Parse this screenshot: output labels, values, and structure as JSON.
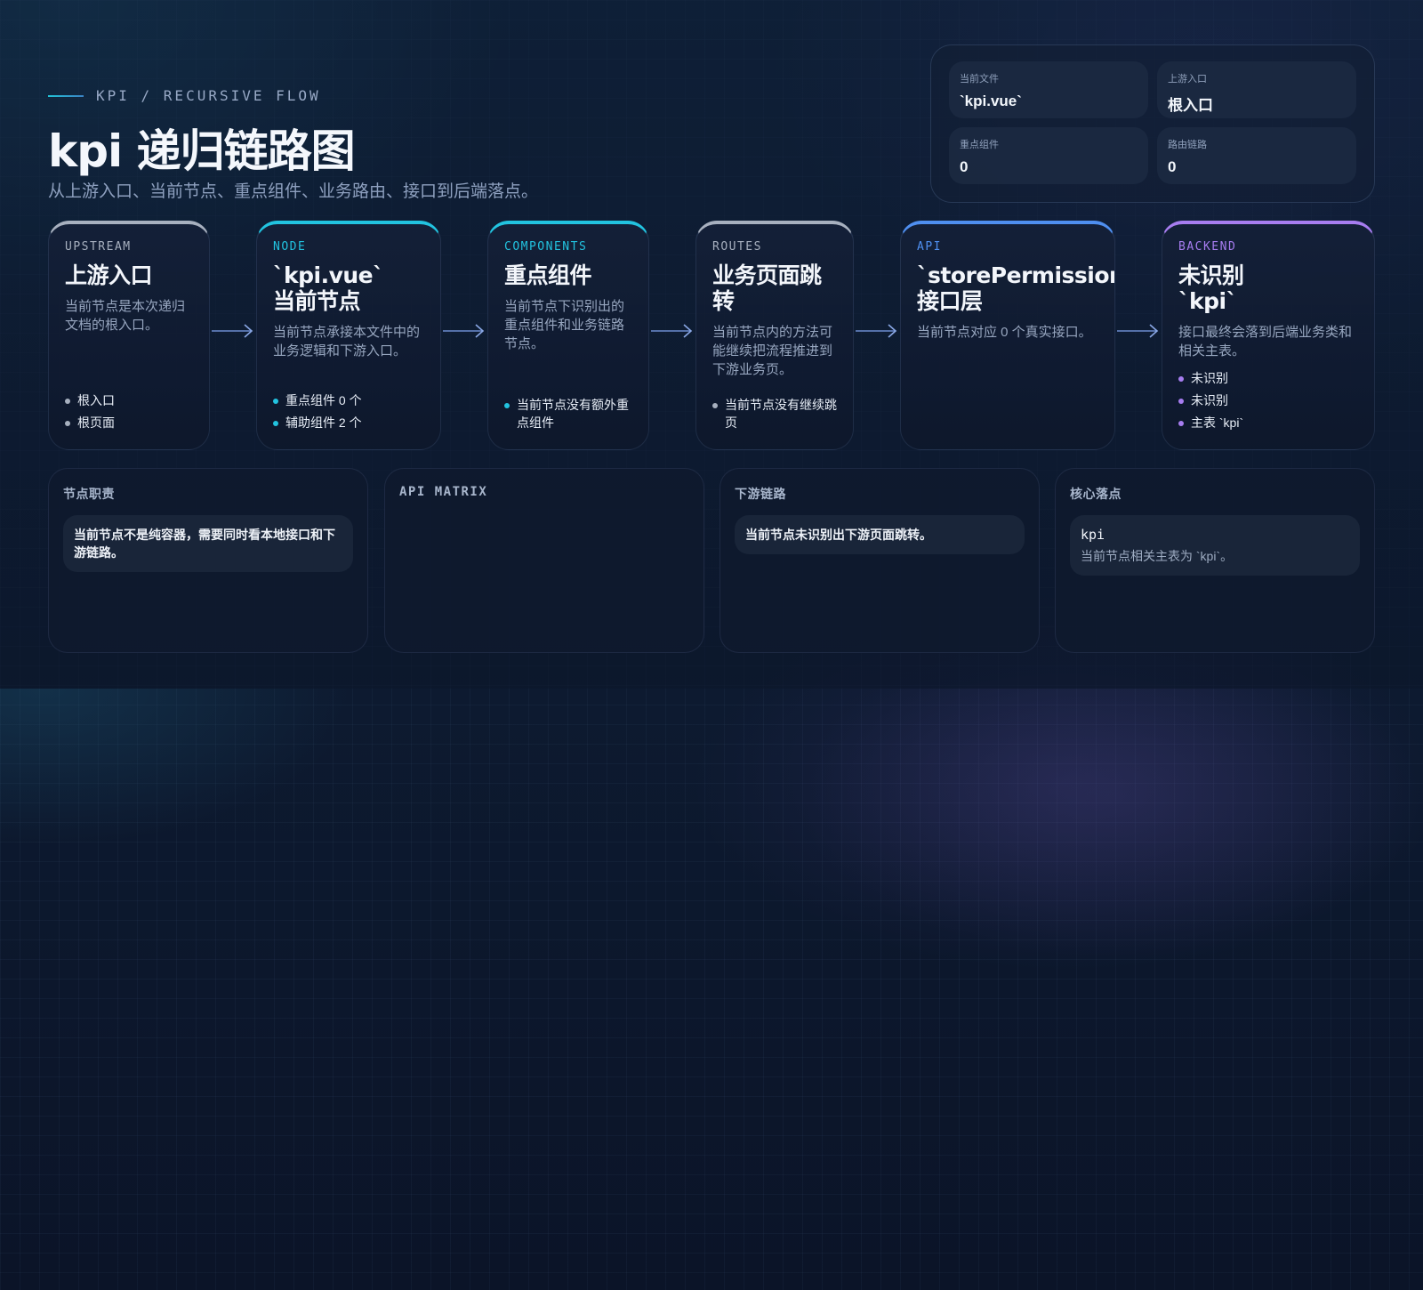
{
  "header": {
    "kicker": "KPI / RECURSIVE FLOW",
    "title": "kpi 递归链路图",
    "subtitle": "从上游入口、当前节点、重点组件、业务路由、接口到后端落点。"
  },
  "stats": [
    {
      "label": "当前文件",
      "value": "`kpi.vue`"
    },
    {
      "label": "上游入口",
      "value": "根入口"
    },
    {
      "label": "重点组件",
      "value": "0"
    },
    {
      "label": "路由链路",
      "value": "0"
    }
  ],
  "flow": [
    {
      "tag": "UPSTREAM",
      "title": "上游入口",
      "desc": "当前节点是本次递归文档的根入口。",
      "bullets": [
        "根入口",
        "根页面"
      ],
      "color": "#a7b0bf"
    },
    {
      "tag": "NODE",
      "title": "`kpi.vue`\n当前节点",
      "desc": "当前节点承接本文件中的业务逻辑和下游入口。",
      "bullets": [
        "重点组件 0 个",
        "辅助组件 2 个"
      ],
      "color": "#22c3e0"
    },
    {
      "tag": "COMPONENTS",
      "title": "重点组件",
      "desc": "当前节点下识别出的重点组件和业务链路节点。",
      "bullets": [
        "当前节点没有额外重点组件"
      ],
      "color": "#22c3e0"
    },
    {
      "tag": "ROUTES",
      "title": "业务页面跳转",
      "desc": "当前节点内的方法可能继续把流程推进到下游业务页。",
      "bullets": [
        "当前节点没有继续跳页"
      ],
      "color": "#a7b0bf"
    },
    {
      "tag": "API",
      "title": "`storePermission.js`\n接口层",
      "desc": "当前节点对应 0 个真实接口。",
      "bullets": [],
      "color": "#4f8ff0"
    },
    {
      "tag": "BACKEND",
      "title": "未识别\n`kpi`",
      "desc": "接口最终会落到后端业务类和相关主表。",
      "bullets": [
        "未识别",
        "未识别",
        "主表 `kpi`"
      ],
      "color": "#a77df0"
    }
  ],
  "panels": {
    "duty": {
      "title": "节点职责",
      "body": "当前节点不是纯容器，需要同时看本地接口和下游链路。"
    },
    "api_matrix": {
      "title": "API MATRIX"
    },
    "downstream": {
      "title": "下游链路",
      "body": "当前节点未识别出下游页面跳转。"
    },
    "core": {
      "title": "核心落点",
      "code": "kpi",
      "body": "当前节点相关主表为 `kpi`。"
    }
  }
}
